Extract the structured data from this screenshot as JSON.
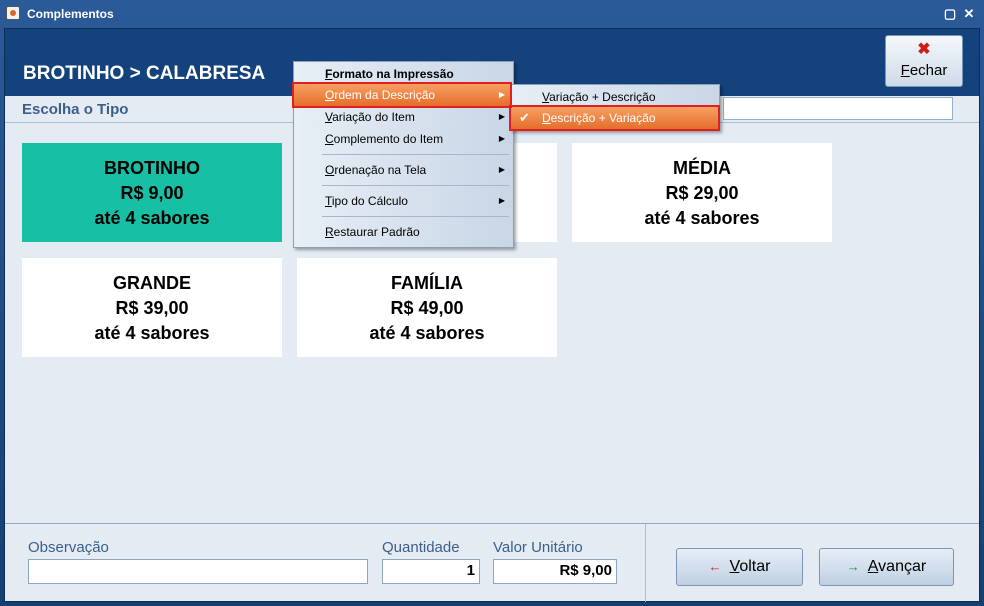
{
  "window": {
    "title": "Complementos"
  },
  "header": {
    "heading": "BROTINHO > CALABRESA",
    "close_button": {
      "underlined": "F",
      "rest": "echar"
    }
  },
  "tipo": {
    "label": "Escolha o Tipo",
    "search_value": ""
  },
  "cards": [
    {
      "name": "BROTINHO",
      "price": "R$ 9,00",
      "flavors": "até 4 sabores",
      "selected": true
    },
    {
      "name": "MÉDIA",
      "price": "R$ 29,00",
      "flavors": "até 4 sabores",
      "selected": false
    },
    {
      "name": "GRANDE",
      "price": "R$ 39,00",
      "flavors": "até 4 sabores",
      "selected": false
    },
    {
      "name": "FAMÍLIA",
      "price": "R$ 49,00",
      "flavors": "até 4 sabores",
      "selected": false
    }
  ],
  "footer": {
    "observacao_label": "Observação",
    "observacao_value": "",
    "quantidade_label": "Quantidade",
    "quantidade_value": "1",
    "valor_label": "Valor Unitário",
    "valor_value": "R$ 9,00",
    "voltar": {
      "underlined": "V",
      "rest": "oltar"
    },
    "avancar": {
      "underlined": "A",
      "rest": "vançar"
    }
  },
  "context_menu": {
    "items": [
      {
        "underlined": "F",
        "rest": "ormato na Impressão",
        "bold": true
      },
      {
        "underlined": "O",
        "rest": "rdem da Descrição",
        "submenu": true
      },
      {
        "underlined": "V",
        "rest": "ariação do Item",
        "submenu": true
      },
      {
        "underlined": "C",
        "rest": "omplemento do Item",
        "submenu": true
      },
      {
        "underlined": "O",
        "rest": "rdenação na Tela",
        "submenu": true
      },
      {
        "underlined": "T",
        "rest": "ipo do Cálculo",
        "submenu": true
      },
      {
        "underlined": "R",
        "rest": "estaurar Padrão"
      }
    ]
  },
  "submenu": {
    "items": [
      {
        "underlined": "V",
        "rest": "ariação + Descrição",
        "checked": false
      },
      {
        "underlined": "D",
        "rest": "escrição + Variação",
        "checked": true
      }
    ]
  },
  "colors": {
    "header_bg": "#14427c",
    "selected_card": "#17bfa4",
    "highlight": "#e56d2c",
    "annotation_box": "#e02020"
  }
}
